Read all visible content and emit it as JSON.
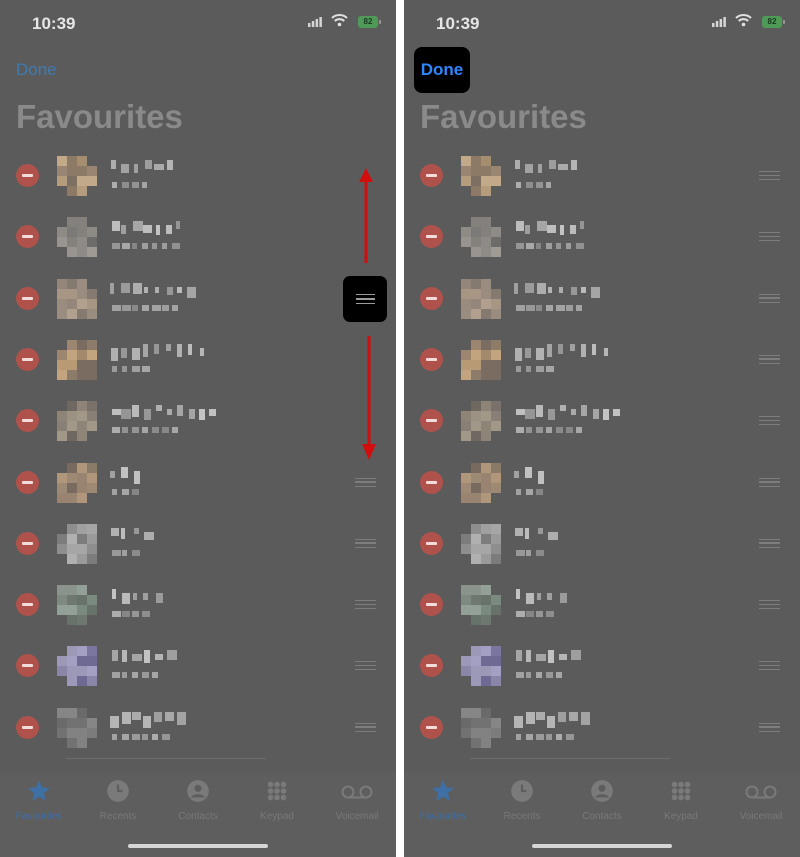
{
  "panels": [
    {
      "time": "10:39",
      "battery": "82",
      "done_label": "Done",
      "title": "Favourites"
    },
    {
      "time": "10:39",
      "battery": "82",
      "done_label": "Done",
      "title": "Favourites"
    }
  ],
  "tabs": [
    {
      "label": "Favourites",
      "icon": "star-icon",
      "active": true
    },
    {
      "label": "Recents",
      "icon": "clock-icon",
      "active": false
    },
    {
      "label": "Contacts",
      "icon": "person-icon",
      "active": false
    },
    {
      "label": "Keypad",
      "icon": "keypad-icon",
      "active": false
    },
    {
      "label": "Voicemail",
      "icon": "voicemail-icon",
      "active": false
    }
  ],
  "colors": {
    "background_dim": "#5b5b5b",
    "delete_red": "#b0524c",
    "accent_blue": "#2f86ff",
    "annotation_red": "#d10d0d",
    "highlight_black": "#000000"
  },
  "annotations": {
    "drag_arrows": [
      "up-arrow-icon",
      "down-arrow-icon"
    ]
  }
}
